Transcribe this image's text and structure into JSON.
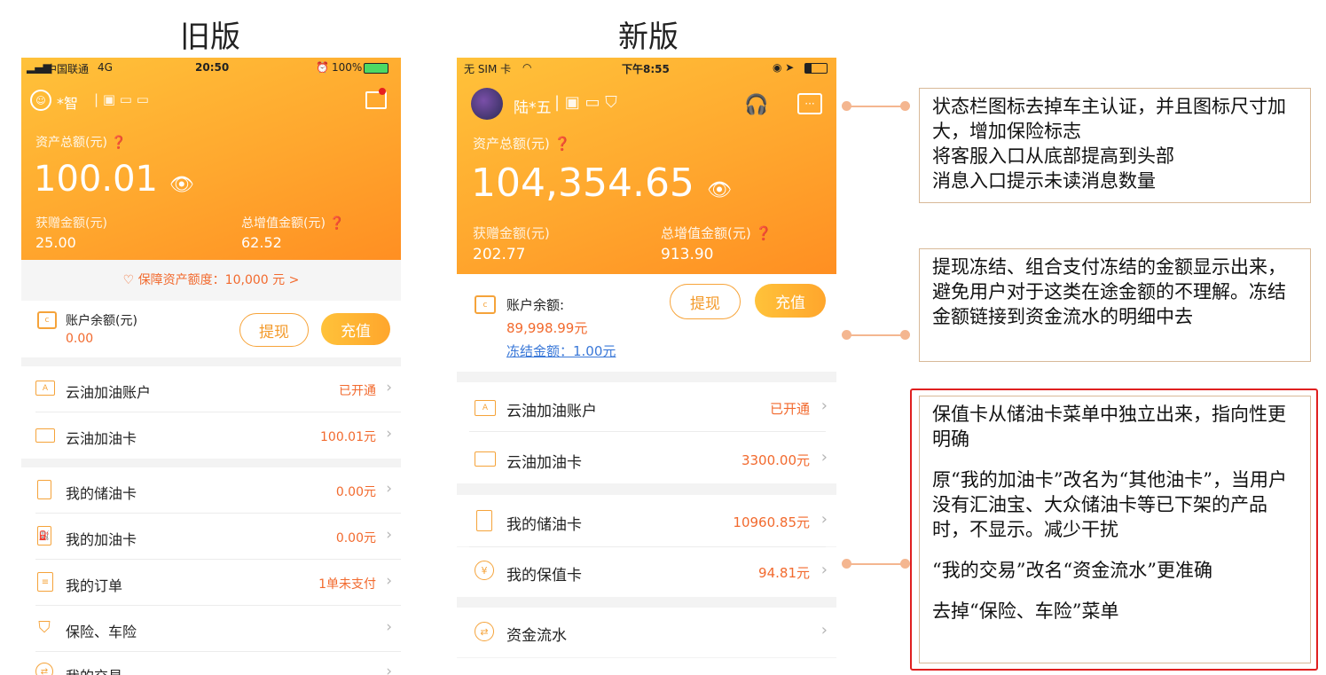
{
  "captions": {
    "old": "旧版",
    "new": "新版"
  },
  "colors": {
    "header_orange": "#ffa72e",
    "value_red": "#f26a2e",
    "note_border": "#d8b998",
    "highlight_red": "#e02020"
  },
  "old_app": {
    "status": {
      "carrier": "中国联通",
      "network": "4G",
      "time": "20:50",
      "battery": "100%"
    },
    "user": {
      "name": "*智"
    },
    "assets": {
      "label": "资产总额(元)",
      "total": "100.01",
      "bonus_label": "获赠金额(元)",
      "bonus": "25.00",
      "added_label": "总增值金额(元)",
      "added": "62.52"
    },
    "protection": "保障资产额度：10,000 元 >",
    "balance": {
      "label": "账户余额(元)",
      "value": "0.00",
      "withdraw": "提现",
      "recharge": "充值"
    },
    "menu": [
      {
        "label": "云油加油账户",
        "value": "已开通"
      },
      {
        "label": "云油加油卡",
        "value": "100.01元"
      },
      {
        "label": "我的储油卡",
        "value": "0.00元"
      },
      {
        "label": "我的加油卡",
        "value": "0.00元"
      },
      {
        "label": "我的订单",
        "value": "1单未支付"
      },
      {
        "label": "保险、车险",
        "value": ""
      },
      {
        "label": "我的交易",
        "value": ""
      }
    ]
  },
  "new_app": {
    "status": {
      "carrier": "无 SIM 卡",
      "time": "下午8:55"
    },
    "user": {
      "name": "陆*五"
    },
    "assets": {
      "label": "资产总额(元)",
      "total": "104,354.65",
      "bonus_label": "获赠金额(元)",
      "bonus": "202.77",
      "added_label": "总增值金额(元)",
      "added": "913.90"
    },
    "balance": {
      "label": "账户余额:",
      "value": "89,998.99元",
      "frozen": "冻结金额：1.00元",
      "withdraw": "提现",
      "recharge": "充值"
    },
    "menu": [
      {
        "label": "云油加油账户",
        "value": "已开通"
      },
      {
        "label": "云油加油卡",
        "value": "3300.00元"
      },
      {
        "label": "我的储油卡",
        "value": "10960.85元"
      },
      {
        "label": "我的保值卡",
        "value": "94.81元"
      },
      {
        "label": "资金流水",
        "value": ""
      }
    ]
  },
  "notes": {
    "n1": [
      "状态栏图标去掉车主认证，并且图标尺寸加大，增加保险标志",
      "将客服入口从底部提高到头部",
      "消息入口提示未读消息数量"
    ],
    "n2": [
      "提现冻结、组合支付冻结的金额显示出来，避免用户对于这类在途金额的不理解。冻结金额链接到资金流水的明细中去"
    ],
    "n3": [
      "保值卡从储油卡菜单中独立出来，指向性更明确",
      "原“我的加油卡”改名为“其他油卡”，当用户没有汇油宝、大众储油卡等已下架的产品时，不显示。减少干扰",
      "“我的交易”改名“资金流水”更准确",
      "去掉“保险、车险”菜单"
    ]
  }
}
